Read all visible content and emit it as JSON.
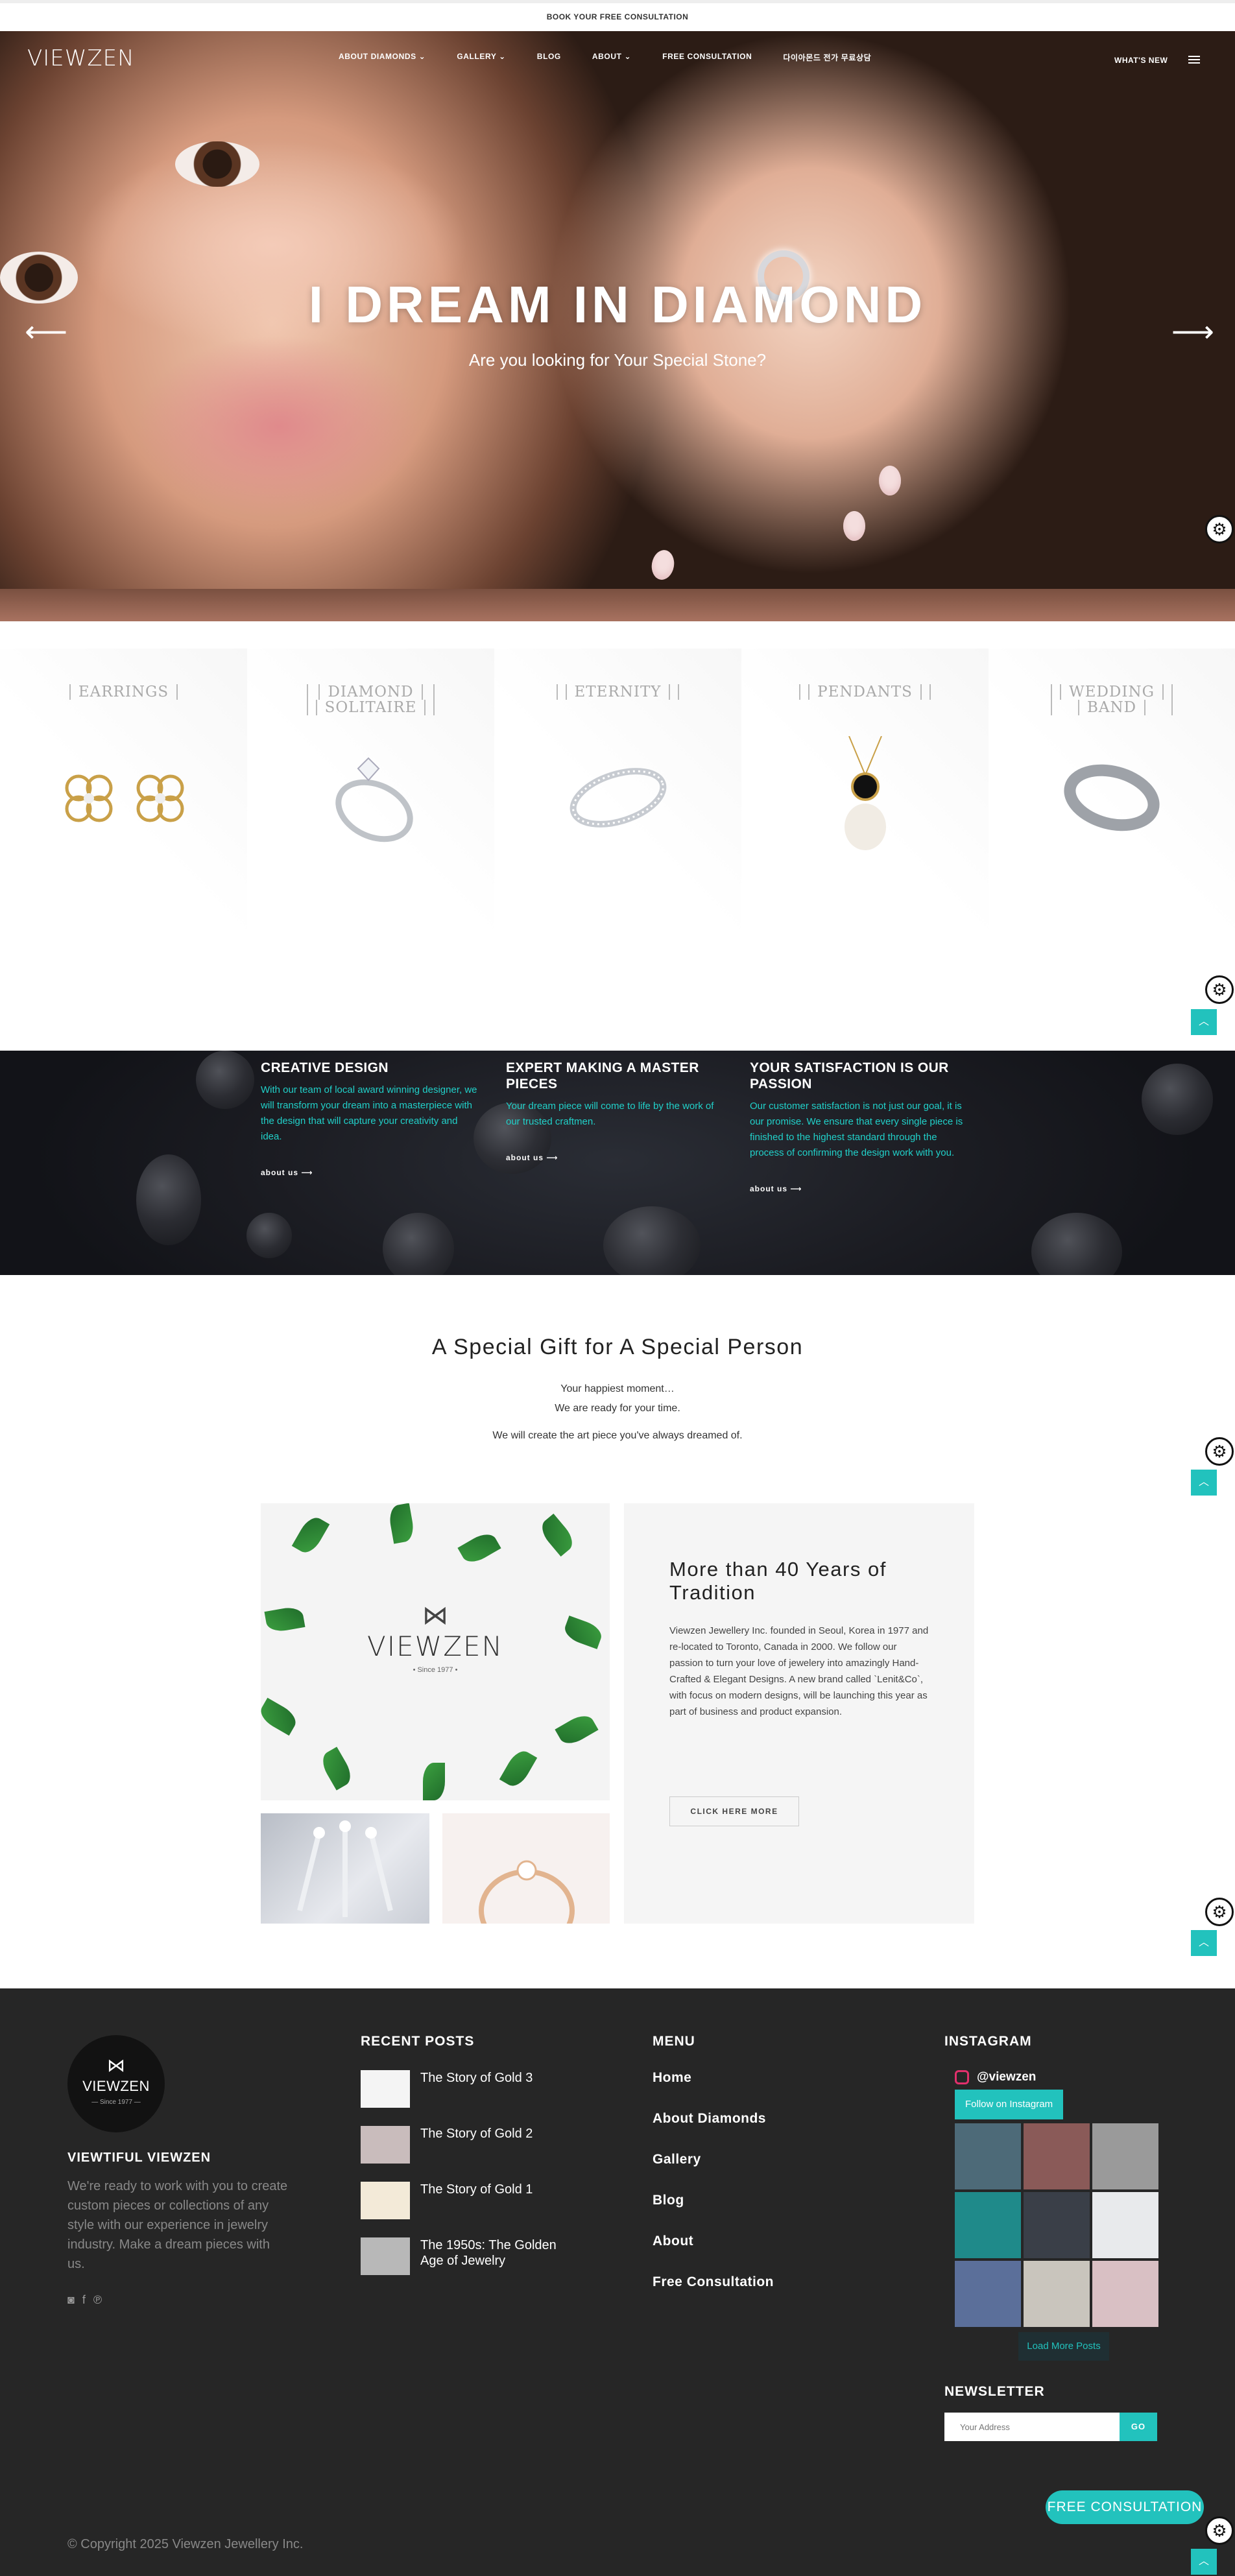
{
  "topbar": {
    "text": "BOOK YOUR FREE CONSULTATION"
  },
  "brand": {
    "logo": "VIEWZEN",
    "accent": "#22c2bd"
  },
  "nav": {
    "items": [
      "ABOUT DIAMONDS ⌄",
      "GALLERY ⌄",
      "BLOG",
      "ABOUT ⌄",
      "FREE CONSULTATION",
      "다이아몬드 전가 무료상담"
    ],
    "whats_new": "WHAT'S NEW"
  },
  "hero": {
    "title": "I DREAM IN DIAMOND",
    "subtitle": "Are you looking for Your Special Stone?",
    "prev": "⟵",
    "next": "⟶"
  },
  "categories": [
    {
      "label_1": "EARRINGS",
      "label_2": ""
    },
    {
      "label_1": "DIAMOND",
      "label_2": "SOLITAIRE"
    },
    {
      "label_1": "ETERNITY",
      "label_2": ""
    },
    {
      "label_1": "PENDANTS",
      "label_2": ""
    },
    {
      "label_1": "WEDDING",
      "label_2": "BAND"
    }
  ],
  "features": [
    {
      "title": "CREATIVE DESIGN",
      "text": "With our team of local award winning designer, we will transform your dream into a masterpiece with the design that will capture your creativity and idea.",
      "more": "about us ⟶"
    },
    {
      "title": "EXPERT MAKING A MASTER PIECES",
      "text": "Your dream piece will come to life by the work of our trusted craftmen.",
      "more": "about us ⟶"
    },
    {
      "title": "YOUR SATISFACTION IS OUR PASSION",
      "text": "Our customer satisfaction is not just our goal, it is our promise. We ensure that every single piece is finished to the highest standard through the process of confirming the design work with you.",
      "more": "about us ⟶"
    }
  ],
  "gift": {
    "title": "A Special Gift for A Special Person",
    "line1": "Your happiest moment…",
    "line2": "We are ready for your time.",
    "line3": "We will create the art piece you've always dreamed of."
  },
  "tile": {
    "logo": "VIEWZEN",
    "since": "• Since 1977 •"
  },
  "about": {
    "title": "More than 40 Years of Tradition",
    "text": "Viewzen Jewellery Inc. founded in Seoul, Korea in 1977 and re-located to Toronto, Canada in 2000. We follow our passion to turn your love of jewelery into amazingly Hand-Crafted & Elegant Designs. A new brand called `Lenit&Co`, with focus on modern designs, will be launching this year as part of business and product expansion.",
    "button": "CLICK HERE MORE"
  },
  "footer": {
    "logo": "VIEWZEN",
    "logo_since": "— Since 1977 —",
    "title": "VIEWTIFUL VIEWZEN",
    "desc": "We're ready to work with you to create custom pieces or collections of any style with our experience in jewelry industry. Make a dream pieces with us.",
    "social": [
      "instagram-icon",
      "facebook-icon",
      "pinterest-icon"
    ],
    "recent_title": "RECENT POSTS",
    "posts": [
      "The Story of Gold 3",
      "The Story of Gold 2",
      "The Story of Gold 1",
      "The 1950s: The Golden Age of Jewelry"
    ],
    "menu_title": "MENU",
    "menu": [
      "Home",
      "About Diamonds",
      "Gallery",
      "Blog",
      "About",
      "Free Consultation"
    ],
    "instagram_title": "INSTAGRAM",
    "ig_handle": "@viewzen",
    "ig_follow": "Follow on Instagram",
    "ig_load": "Load More Posts",
    "newsletter_title": "NEWSLETTER",
    "newsletter_placeholder": "Your Address",
    "newsletter_go": "GO",
    "consult": "FREE CONSULTATION",
    "copyright": "© Copyright 2025 Viewzen Jewellery Inc."
  }
}
